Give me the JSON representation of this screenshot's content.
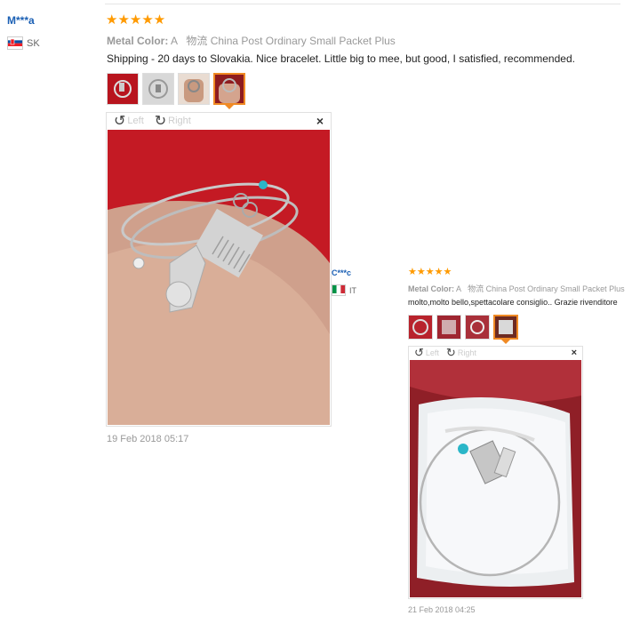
{
  "review1": {
    "user": "M***a",
    "country": "SK",
    "stars": "★★★★★",
    "metal_label": "Metal Color:",
    "metal_value": "A",
    "shipping": "物流 China Post Ordinary Small Packet Plus",
    "comment": "Shipping - 20 days to Slovakia. Nice bracelet. Little big to mee, but good, I satisfied, recommended.",
    "viewer": {
      "left": "Left",
      "right": "Right",
      "close": "×"
    },
    "date": "19 Feb 2018 05:17"
  },
  "review2": {
    "user": "C***c",
    "country": "IT",
    "stars": "★★★★★",
    "metal_label": "Metal Color:",
    "metal_value": "A",
    "shipping": "物流 China Post Ordinary Small Packet Plus",
    "comment": "molto,molto bello,spettacolare consiglio.. Grazie rivenditore",
    "viewer": {
      "left": "Left",
      "right": "Right",
      "close": "×"
    },
    "date": "21 Feb 2018 04:25"
  },
  "colors": {
    "star": "#ff9a00",
    "accent": "#f08a24",
    "user": "#1a5fb4"
  },
  "icons": [
    "rotate-left-icon",
    "rotate-right-icon",
    "close-icon",
    "flag-sk-icon",
    "flag-it-icon"
  ]
}
